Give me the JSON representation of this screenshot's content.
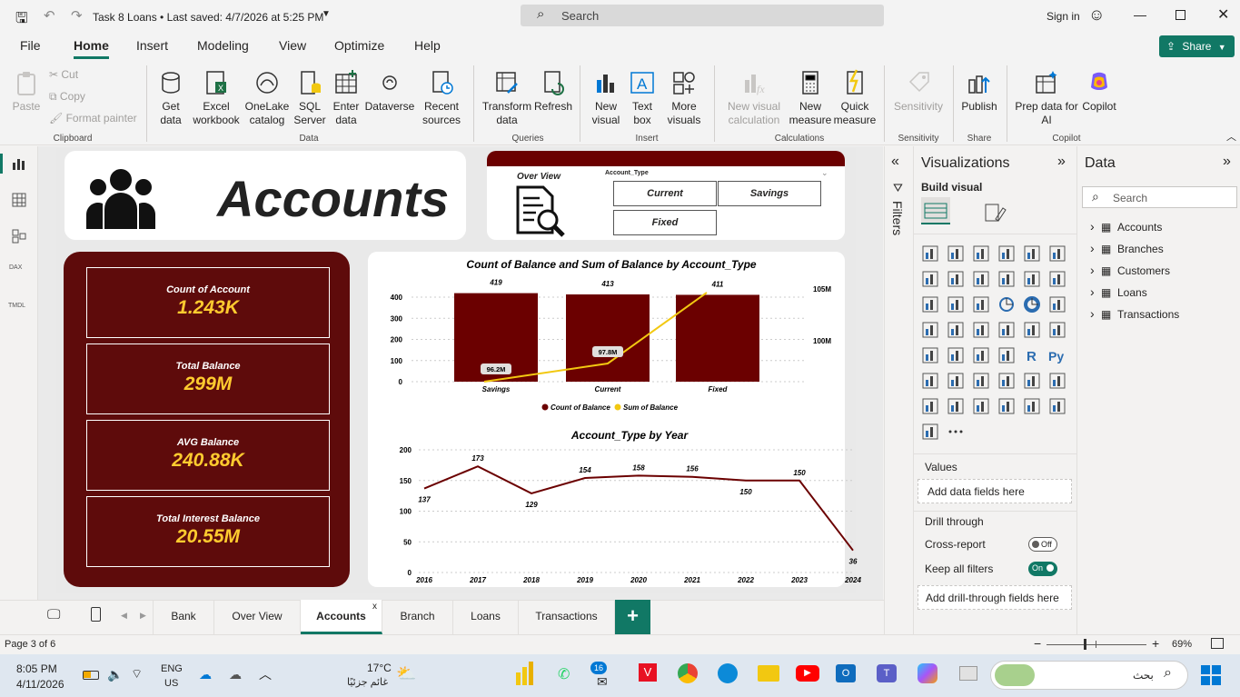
{
  "window": {
    "doc_title": "Task 8 Loans • Last saved: 4/7/2026 at 5:25 PM",
    "search_placeholder": "Search",
    "sign_in": "Sign in"
  },
  "ribbon": {
    "menu": [
      "File",
      "Home",
      "Insert",
      "Modeling",
      "View",
      "Optimize",
      "Help"
    ],
    "share": "Share",
    "clipboard": {
      "paste": "Paste",
      "cut": "Cut",
      "copy": "Copy",
      "format_painter": "Format painter",
      "group": "Clipboard"
    },
    "data": {
      "get_data": "Get data",
      "excel": "Excel workbook",
      "onelake": "OneLake catalog",
      "sql": "SQL Server",
      "enter": "Enter data",
      "dataverse": "Dataverse",
      "recent": "Recent sources",
      "group": "Data"
    },
    "queries": {
      "transform": "Transform data",
      "refresh": "Refresh",
      "group": "Queries"
    },
    "insert": {
      "new_visual": "New visual",
      "text_box": "Text box",
      "more_visuals": "More visuals",
      "group": "Insert"
    },
    "calculations": {
      "new_visual_calc": "New visual calculation",
      "new_measure": "New measure",
      "quick_measure": "Quick measure",
      "group": "Calculations"
    },
    "sensitivity": {
      "label": "Sensitivity",
      "group": "Sensitivity"
    },
    "share_grp": {
      "publish": "Publish",
      "group": "Share"
    },
    "copilot": {
      "prep": "Prep data for AI",
      "copilot": "Copilot",
      "group": "Copilot"
    }
  },
  "report": {
    "title": "Accounts",
    "overview_label": "Over View",
    "slicer_title": "Account_Type",
    "slicer_items": [
      "Current",
      "Savings",
      "Fixed"
    ],
    "kpis": [
      {
        "label": "Count of Account",
        "value": "1.243K"
      },
      {
        "label": "Total Balance",
        "value": "299M"
      },
      {
        "label": "AVG Balance",
        "value": "240.88K"
      },
      {
        "label": "Total Interest Balance",
        "value": "20.55M"
      }
    ],
    "colors": {
      "maroon": "#6b0000",
      "kpi_bg": "#5e0b0b",
      "gold": "#ffcb2f",
      "line": "#f2c811"
    }
  },
  "chart_data": [
    {
      "type": "bar",
      "title": "Count of Balance and Sum of Balance by Account_Type",
      "categories": [
        "Savings",
        "Current",
        "Fixed"
      ],
      "series": [
        {
          "name": "Count of Balance",
          "values": [
            419,
            413,
            411
          ],
          "labels": [
            "419",
            "413",
            "411"
          ]
        },
        {
          "name": "Sum of Balance",
          "values": [
            96.2,
            97.8,
            105
          ],
          "labels": [
            "96.2M",
            "97.8M",
            ""
          ]
        }
      ],
      "y_ticks": [
        "400",
        "300",
        "200",
        "100",
        "0"
      ],
      "y2_ticks": [
        "105M",
        "100M"
      ],
      "legend": [
        "Count of Balance",
        "Sum of Balance"
      ]
    },
    {
      "type": "line",
      "title": "Account_Type by Year",
      "x": [
        "2016",
        "2017",
        "2018",
        "2019",
        "2020",
        "2021",
        "2022",
        "2023",
        "2024"
      ],
      "values": [
        137,
        173,
        129,
        154,
        158,
        156,
        150,
        150,
        36
      ],
      "y_ticks": [
        "200",
        "150",
        "100",
        "50",
        "0"
      ],
      "ylim": [
        0,
        200
      ]
    }
  ],
  "viz_pane": {
    "title": "Visualizations",
    "build_visual": "Build visual",
    "values": "Values",
    "add_data": "Add data fields here",
    "drill_through": "Drill through",
    "cross_report": "Cross-report",
    "cross_state": "Off",
    "keep_filters": "Keep all filters",
    "keep_state": "On",
    "add_drill": "Add drill-through fields here"
  },
  "filters_label": "Filters",
  "data_pane": {
    "title": "Data",
    "search": "Search",
    "tables": [
      "Accounts",
      "Branches",
      "Customers",
      "Loans",
      "Transactions"
    ]
  },
  "tabs": [
    "Bank",
    "Over View",
    "Accounts",
    "Branch",
    "Loans",
    "Transactions"
  ],
  "status": {
    "page": "Page 3 of 6",
    "zoom": "69%"
  },
  "taskbar": {
    "time": "8:05 PM",
    "date": "4/11/2026",
    "lang1": "ENG",
    "lang2": "US",
    "temp": "17°C",
    "weather": "غائم جزئيًا",
    "search": "بحث",
    "badge": "16"
  }
}
